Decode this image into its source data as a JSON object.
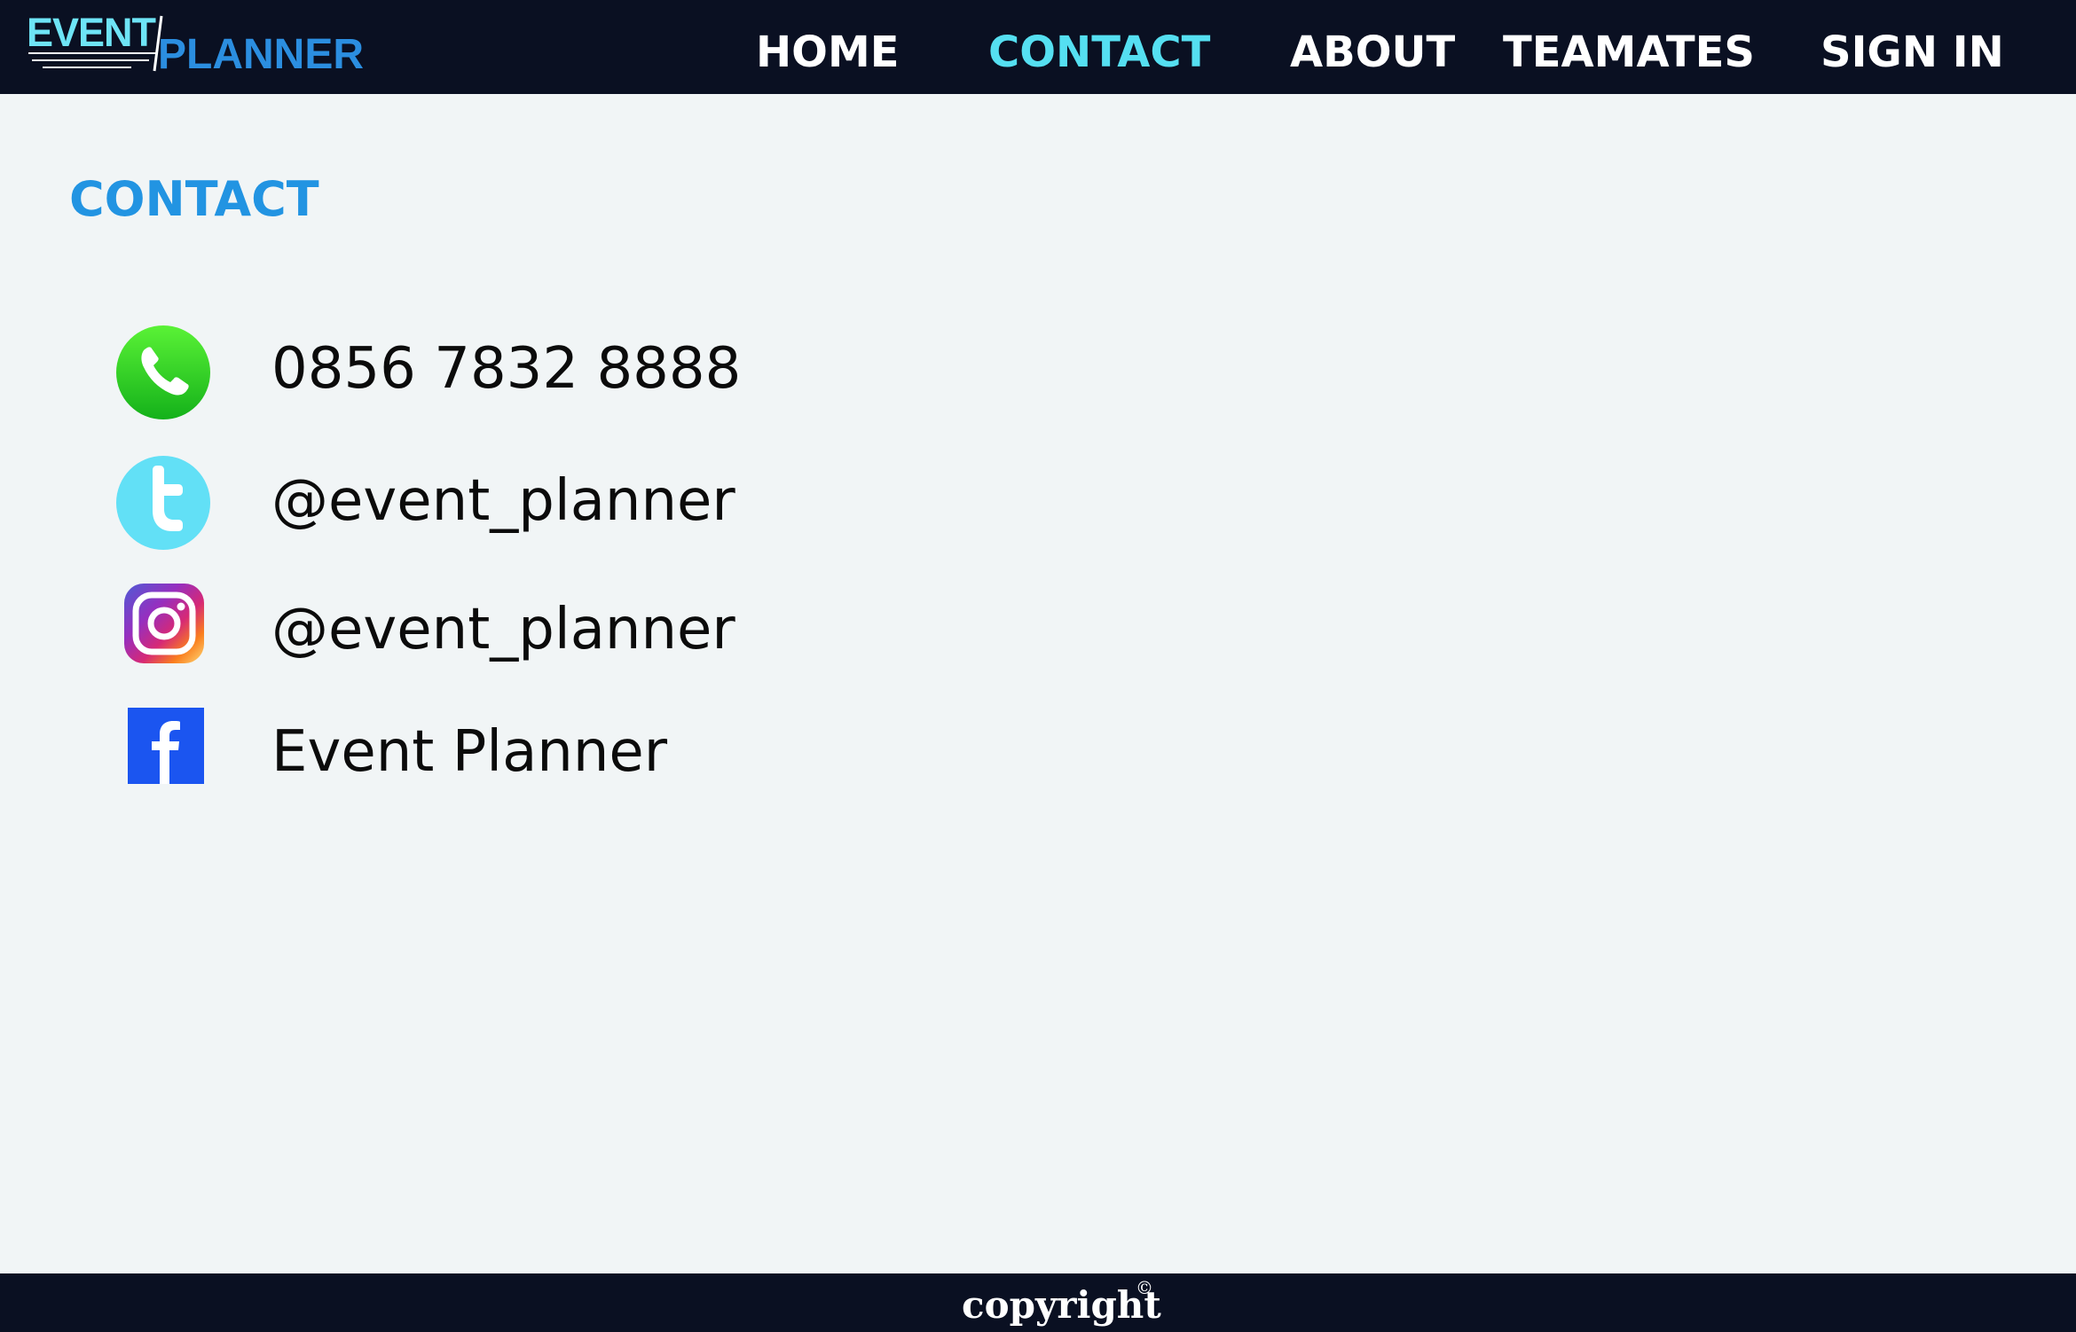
{
  "header": {
    "logo": {
      "word1": "EVENT",
      "word2": "PLANNER"
    },
    "nav": [
      {
        "label": "HOME",
        "active": false
      },
      {
        "label": "CONTACT",
        "active": true
      },
      {
        "label": "ABOUT",
        "active": false
      },
      {
        "label": "TEAMATES",
        "active": false
      },
      {
        "label": "SIGN IN",
        "active": false
      }
    ]
  },
  "main": {
    "title": "CONTACT",
    "contacts": [
      {
        "icon": "whatsapp-phone-icon",
        "value": "0856 7832 8888"
      },
      {
        "icon": "twitter-icon",
        "value": "@event_planner"
      },
      {
        "icon": "instagram-icon",
        "value": "@event_planner"
      },
      {
        "icon": "facebook-icon",
        "value": "Event Planner"
      }
    ]
  },
  "footer": {
    "text": "copyright",
    "symbol": "©"
  },
  "colors": {
    "nav_bg": "#0a1022",
    "page_bg": "#f1f5f6",
    "active_nav": "#55dff1",
    "title_blue": "#2294e2",
    "logo_cyan": "#6ee4f6",
    "logo_blue": "#2b8ee0"
  }
}
